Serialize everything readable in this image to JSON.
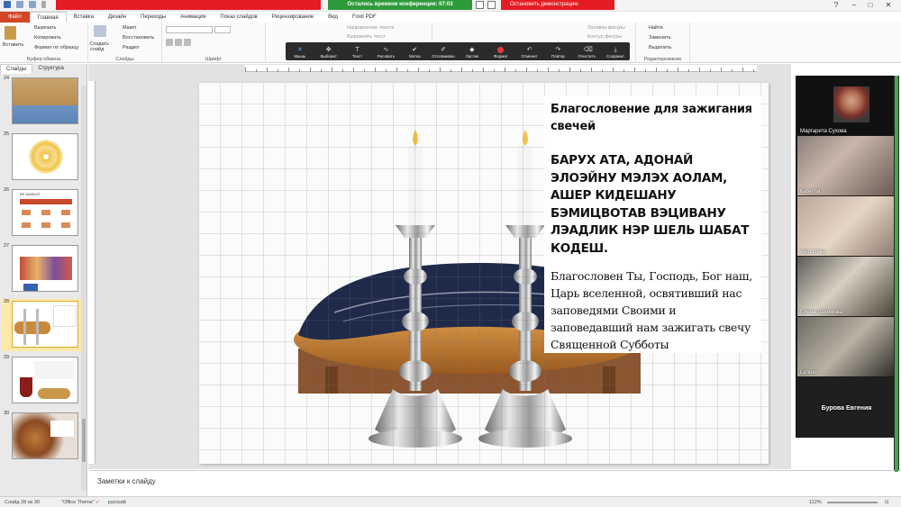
{
  "titlebar": {
    "meeting_timer": "Осталось времени конференции: 07:03",
    "stop_demo": "Остановить демонстрацию"
  },
  "tabs": [
    "Файл",
    "Главная",
    "Вставка",
    "Дизайн",
    "Переходы",
    "Анимация",
    "Показ слайдов",
    "Рецензирование",
    "Вид",
    "Foxit PDF"
  ],
  "ribbon": {
    "paste": "Вставить",
    "cut": "Вырезать",
    "copy": "Копировать",
    "format_painter": "Формат по образцу",
    "clipboard_group": "Буфер обмена",
    "new_slide": "Создать слайд",
    "layout": "Макет",
    "reset": "Восстановить",
    "section": "Раздел",
    "slides_group": "Слайды",
    "font_group": "Шрифт",
    "text_direction": "Направление текста",
    "align_text": "Выровнять текст",
    "fill": "Заливка фигуры",
    "outline": "Контур фигуры",
    "find": "Найти",
    "replace": "Заменить",
    "select": "Выделить",
    "editing_group": "Редактирование"
  },
  "annotate_tools": [
    {
      "label": "Мышь",
      "icon": "pointer-icon",
      "glyph": "✕",
      "selected": true
    },
    {
      "label": "Выберит",
      "icon": "select-icon",
      "glyph": "✥"
    },
    {
      "label": "Текст",
      "icon": "text-icon",
      "glyph": "T"
    },
    {
      "label": "Рисовать",
      "icon": "draw-icon",
      "glyph": "∿"
    },
    {
      "label": "Метка",
      "icon": "stamp-icon",
      "glyph": "✔"
    },
    {
      "label": "Отслеживан",
      "icon": "spotlight-icon",
      "glyph": "✐"
    },
    {
      "label": "Ластик",
      "icon": "eraser-icon",
      "glyph": "◆"
    },
    {
      "label": "Формат",
      "icon": "format-icon",
      "glyph": " ",
      "red": true
    },
    {
      "label": "Отменит",
      "icon": "undo-icon",
      "glyph": "↶"
    },
    {
      "label": "Повтор",
      "icon": "redo-icon",
      "glyph": "↷"
    },
    {
      "label": "Очистить",
      "icon": "clear-icon",
      "glyph": "⌫"
    },
    {
      "label": "Сохранит",
      "icon": "save-icon",
      "glyph": "⤓"
    }
  ],
  "panel": {
    "tab_slides": "Слайды",
    "tab_structure": "Структура",
    "slides": [
      {
        "num": "24"
      },
      {
        "num": "25"
      },
      {
        "num": "26"
      },
      {
        "num": "27"
      },
      {
        "num": "28"
      },
      {
        "num": "29"
      },
      {
        "num": "30"
      }
    ],
    "thumb26_title": "ВЕ ШАББАТ"
  },
  "slide": {
    "title": "Благословение для зажигания свечей",
    "blessing_caps": "БАРУХ АТА, АДОНАЙ ЭЛОЭЙНУ МЭЛЭХ АОЛАМ, АШЕР КИДЕШАНУ БЭМИЦВОТАВ ВЭЦИВАНУ ЛЭАДЛИК НЭР ШЕЛЬ ШАБАТ КОДЕШ.",
    "translation": "Благословен Ты, Господь, Бог наш, Царь вселенной, освятивший нас заповедями Своими и заповедавший нам  зажигать свечу Священной Субботы"
  },
  "notes_placeholder": "Заметки к слайду",
  "status": {
    "slide_counter": "Слайд 28 из 30",
    "theme": "\"Office Theme\"",
    "language": "русский",
    "zoom": "112%"
  },
  "participants": [
    {
      "name": "Маргарита Сухова"
    },
    {
      "name": "Katerina"
    },
    {
      "name": "Alenushka"
    },
    {
      "name": "Елена Пахомова"
    },
    {
      "name": "Lenovo"
    },
    {
      "name": "Бурова Евгения"
    }
  ]
}
